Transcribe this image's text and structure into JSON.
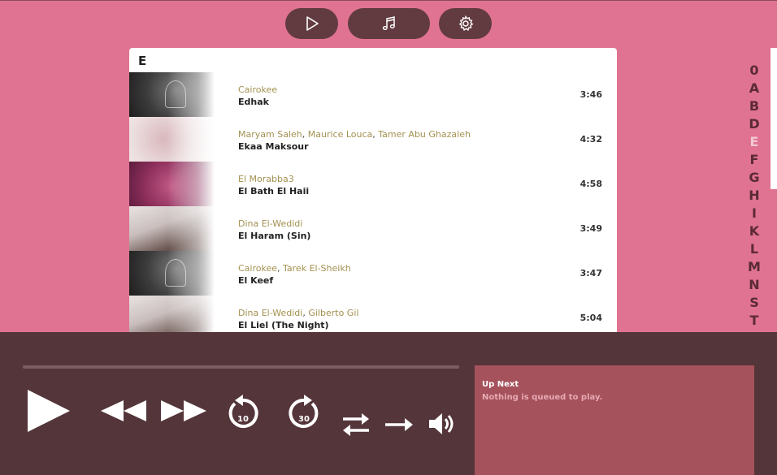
{
  "nav": {
    "play_tab": {
      "icon": "play-outline-icon"
    },
    "music_tab": {
      "icon": "music-note-icon"
    },
    "settings_tab": {
      "icon": "gear-icon"
    }
  },
  "list": {
    "section_letter": "E",
    "tracks": [
      {
        "artists": [
          "Cairokee"
        ],
        "title": "Edhak",
        "duration": "3:46",
        "thumb": "cairokee-cover"
      },
      {
        "artists": [
          "Maryam Saleh",
          "Maurice Louca",
          "Tamer Abu Ghazaleh"
        ],
        "title": "Ekaa Maksour",
        "duration": "4:32",
        "thumb": "lekhfa-cover"
      },
      {
        "artists": [
          "El Morabba3"
        ],
        "title": "El Bath El Haii",
        "duration": "4:58",
        "thumb": "morabba3-cover"
      },
      {
        "artists": [
          "Dina El-Wedidi"
        ],
        "title": "El Haram (Sin)",
        "duration": "3:49",
        "thumb": "dina-cover"
      },
      {
        "artists": [
          "Cairokee",
          "Tarek El-Sheikh"
        ],
        "title": "El Keef",
        "duration": "3:47",
        "thumb": "cairokee-cover"
      },
      {
        "artists": [
          "Dina El-Wedidi",
          "Gilberto Gil"
        ],
        "title": "El Liel (The Night)",
        "duration": "5:04",
        "thumb": "dina-cover"
      }
    ]
  },
  "index": {
    "letters": [
      "0",
      "A",
      "B",
      "D",
      "E",
      "F",
      "G",
      "H",
      "I",
      "K",
      "L",
      "M",
      "N",
      "S",
      "T"
    ],
    "active": "E"
  },
  "player": {
    "progress": 0,
    "skip_back_seconds": "10",
    "skip_forward_seconds": "30"
  },
  "up_next": {
    "title": "Up Next",
    "empty_message": "Nothing is queued to play."
  },
  "colors": {
    "background": "#e07391",
    "player_bg": "#543539",
    "up_next_bg": "#a6525d",
    "artist_link": "#a39150",
    "nav_button": "#623b40"
  }
}
